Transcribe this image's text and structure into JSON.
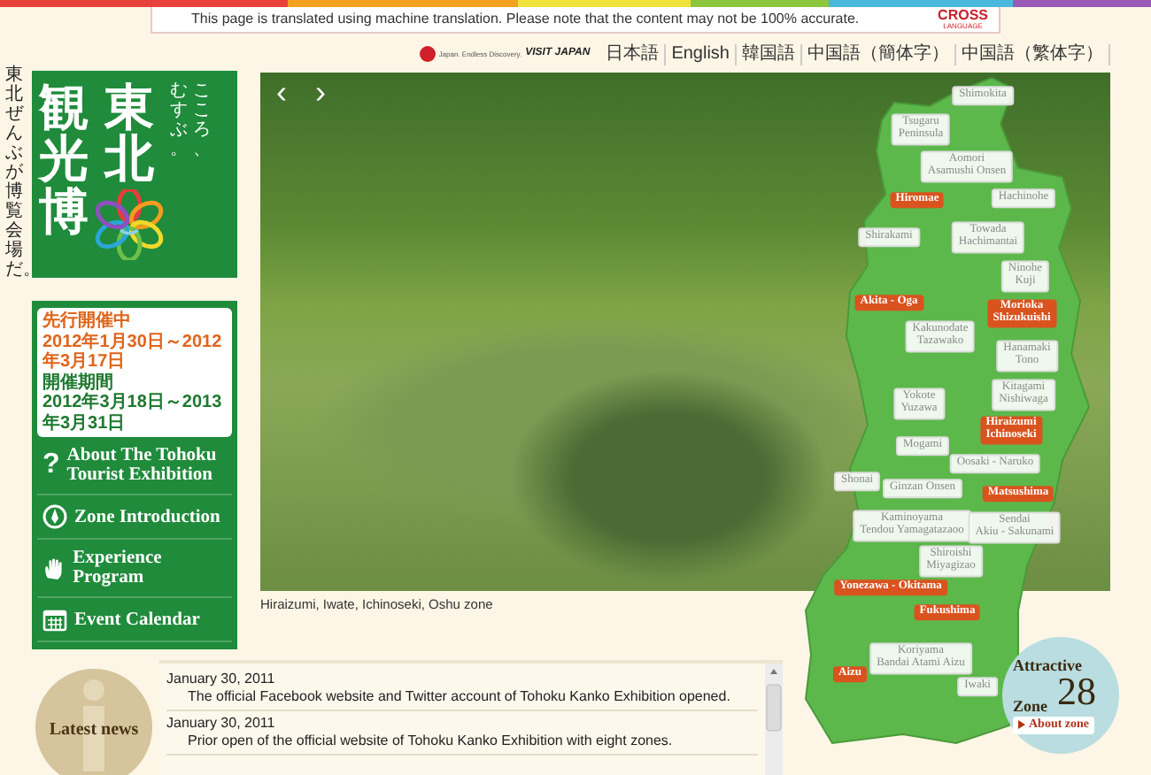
{
  "notice": {
    "text": "This page is translated using machine translation. Please note that the content may not be 100% accurate.",
    "brand": "CROSS",
    "brand_sub": "LANGUAGE"
  },
  "side_slogan": "東北ぜんぶが博覧会場だ。",
  "logo": {
    "title": "観光博",
    "region": "東北",
    "tagline": "こころ、むすぶ。"
  },
  "schedule": [
    {
      "kind": "preview",
      "label": "先行開催中",
      "dates": "2012年1月30日～2012年3月17日"
    },
    {
      "kind": "main",
      "label": "開催期間",
      "dates": "2012年3月18日～2013年3月31日"
    }
  ],
  "menu": [
    {
      "kind": "about",
      "icon_text": "?",
      "label": "About The Tohoku Tourist Exhibition"
    },
    {
      "kind": "zones",
      "label": "Zone Introduction"
    },
    {
      "kind": "program",
      "label": "Experience Program"
    },
    {
      "kind": "calendar",
      "label": "Event Calendar"
    }
  ],
  "partner_logo": {
    "tagline": "Japan. Endless Discovery.",
    "text": "VISIT JAPAN"
  },
  "languages": [
    "日本語",
    "English",
    "韓国語",
    "中国語（簡体字）",
    "中国語（繁体字）"
  ],
  "slideshow": {
    "prev": "‹",
    "next": "›",
    "caption": "Hiraizumi, Iwate, Ichinoseki, Oshu zone"
  },
  "map_labels": [
    {
      "kind": "spot",
      "lines": [
        "Shimokita"
      ]
    },
    {
      "kind": "spot",
      "lines": [
        "Tsugaru",
        "Peninsula"
      ]
    },
    {
      "kind": "spot",
      "lines": [
        "Aomori",
        "Asamushi Onsen"
      ]
    },
    {
      "kind": "hub",
      "lines": [
        "Hiromae"
      ]
    },
    {
      "kind": "spot",
      "lines": [
        "Hachinohe"
      ]
    },
    {
      "kind": "spot",
      "lines": [
        "Shirakami"
      ]
    },
    {
      "kind": "spot",
      "lines": [
        "Towada",
        "Hachimantai"
      ]
    },
    {
      "kind": "spot",
      "lines": [
        "Ninohe",
        "Kuji"
      ]
    },
    {
      "kind": "hub",
      "lines": [
        "Akita - Oga"
      ]
    },
    {
      "kind": "hub",
      "lines": [
        "Morioka",
        "Shizukuishi"
      ]
    },
    {
      "kind": "spot",
      "lines": [
        "Kakunodate",
        "Tazawako"
      ]
    },
    {
      "kind": "spot",
      "lines": [
        "Hanamaki",
        "Tono"
      ]
    },
    {
      "kind": "spot",
      "lines": [
        "Yokote",
        "Yuzawa"
      ]
    },
    {
      "kind": "spot",
      "lines": [
        "Kitagami",
        "Nishiwaga"
      ]
    },
    {
      "kind": "hub",
      "lines": [
        "Hiraizumi",
        "Ichinoseki"
      ]
    },
    {
      "kind": "spot",
      "lines": [
        "Mogami"
      ]
    },
    {
      "kind": "spot",
      "lines": [
        "Oosaki - Naruko"
      ]
    },
    {
      "kind": "spot",
      "lines": [
        "Shonai"
      ]
    },
    {
      "kind": "spot",
      "lines": [
        "Ginzan Onsen"
      ]
    },
    {
      "kind": "hub",
      "lines": [
        "Matsushima"
      ]
    },
    {
      "kind": "spot",
      "lines": [
        "Kaminoyama",
        "Tendou Yamagatazaoo"
      ]
    },
    {
      "kind": "spot",
      "lines": [
        "Sendai",
        "Akiu - Sakunami"
      ]
    },
    {
      "kind": "spot",
      "lines": [
        "Shiroishi",
        "Miyagizao"
      ]
    },
    {
      "kind": "hub",
      "lines": [
        "Yonezawa - Okitama"
      ]
    },
    {
      "kind": "hub",
      "lines": [
        "Fukushima"
      ]
    },
    {
      "kind": "spot",
      "lines": [
        "Koriyama",
        "Bandai  Atami Aizu"
      ]
    },
    {
      "kind": "hub",
      "lines": [
        "Aizu"
      ]
    },
    {
      "kind": "spot",
      "lines": [
        "Iwaki"
      ]
    }
  ],
  "news": {
    "heading": "Latest news",
    "items": [
      {
        "date": "January 30, 2011",
        "text": "The official Facebook website and Twitter account of Tohoku Kanko Exhibition opened."
      },
      {
        "date": "January 30, 2011",
        "text": "Prior open of the official website of Tohoku Kanko Exhibition with eight zones."
      }
    ]
  },
  "zone_badge": {
    "title": "Attractive",
    "word": "Zone",
    "count": "28",
    "link": "About zone"
  }
}
